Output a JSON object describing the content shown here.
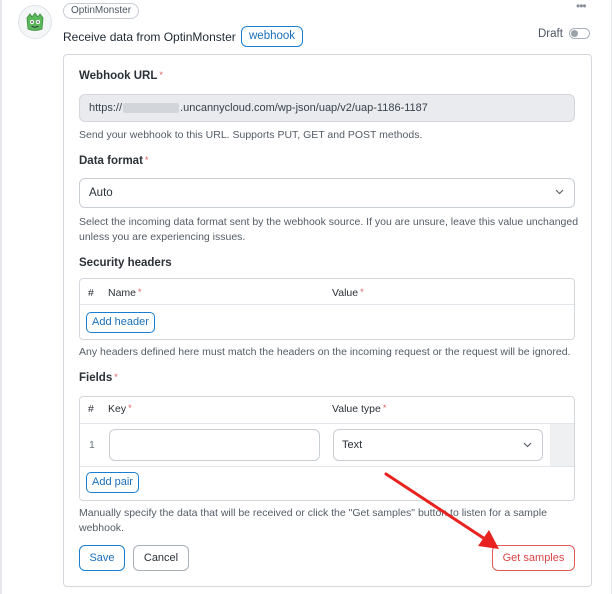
{
  "header": {
    "integration_badge": "OptinMonster",
    "trigger_title": "Receive data from OptinMonster",
    "token_pill": "webhook",
    "draft_label": "Draft"
  },
  "webhook_url": {
    "label": "Webhook URL",
    "required_mark": "*",
    "value_prefix": "https://",
    "value_suffix": ".uncannycloud.com/wp-json/uap/v2/uap-1186-1187",
    "help": "Send your webhook to this URL. Supports PUT, GET and POST methods."
  },
  "data_format": {
    "label": "Data format",
    "required_mark": "*",
    "selected": "Auto",
    "help": "Select the incoming data format sent by the webhook source. If you are unsure, leave this value unchanged unless you are experiencing issues."
  },
  "security_headers": {
    "label": "Security headers",
    "columns": {
      "number": "#",
      "name": "Name",
      "value": "Value"
    },
    "required_mark": "*",
    "add_button": "Add header",
    "help": "Any headers defined here must match the headers on the incoming request or the request will be ignored."
  },
  "fields": {
    "label": "Fields",
    "required_mark": "*",
    "columns": {
      "number": "#",
      "key": "Key",
      "value_type": "Value type"
    },
    "rows": [
      {
        "number": "1",
        "key": "",
        "value_type": "Text"
      }
    ],
    "add_button": "Add pair",
    "help": "Manually specify the data that will be received or click the \"Get samples\" button to listen for a sample webhook."
  },
  "actions": {
    "save": "Save",
    "cancel": "Cancel",
    "get_samples": "Get samples"
  },
  "colors": {
    "accent": "#1a7fd0",
    "danger": "#e35a5a",
    "arrow": "#e8231f",
    "required": "#e05b5b"
  },
  "icons": [
    "optinmonster-logo-icon",
    "more-dots-icon",
    "chevron-down-icon",
    "annotation-arrow"
  ]
}
